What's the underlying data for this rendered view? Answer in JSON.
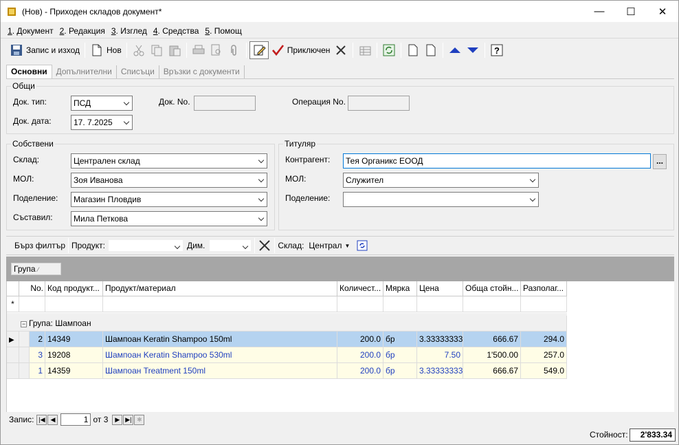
{
  "window": {
    "title": "(Нов) - Приходен складов документ*",
    "minimize": "—",
    "maximize": "☐",
    "close": "✕"
  },
  "menu": [
    {
      "key": "1",
      "label": ". Документ"
    },
    {
      "key": "2",
      "label": ". Редакция"
    },
    {
      "key": "3",
      "label": ". Изглед"
    },
    {
      "key": "4",
      "label": ". Средства"
    },
    {
      "key": "5",
      "label": ". Помощ"
    }
  ],
  "toolbar": {
    "save_exit": "Запис и изход",
    "new": "Нов",
    "finished": "Приключен"
  },
  "tabs": [
    "Основни",
    "Допълнителни",
    "Списъци",
    "Връзки с документи"
  ],
  "general": {
    "title": "Общи",
    "doc_type_label": "Док. тип:",
    "doc_type": "ПСД",
    "doc_no_label": "Док. No.",
    "doc_no": "",
    "operation_label": "Операция No.",
    "operation": "",
    "doc_date_label": "Док. дата:",
    "doc_date": "17.  7.2025"
  },
  "own": {
    "title": "Собствени",
    "warehouse_label": "Склад:",
    "warehouse": "Централен склад",
    "mol_label": "МОЛ:",
    "mol": "Зоя Иванова",
    "division_label": "Поделение:",
    "division": "Магазин Пловдив",
    "author_label": "Съставил:",
    "author": "Мила Петкова"
  },
  "holder": {
    "title": "Титуляр",
    "partner_label": "Контрагент:",
    "partner": "Тея Органикс ЕООД",
    "mol_label": "МОЛ:",
    "mol": "Служител",
    "division_label": "Поделение:",
    "division": "",
    "button": "..."
  },
  "filter": {
    "quick": "Бърз филтър",
    "product_label": "Продукт:",
    "product": "",
    "dim_label": "Дим.",
    "dim": "",
    "warehouse_label": "Склад:",
    "warehouse": "Централ"
  },
  "grouping": {
    "chip": "Група"
  },
  "grid": {
    "columns": [
      "No.",
      "Код продукт...",
      "Продукт/материал",
      "Количест...",
      "Мярка",
      "Цена",
      "Обща стойн...",
      "Разполаг..."
    ],
    "new_row_marker": "*",
    "group_label": "Група: Шампоан",
    "rows": [
      {
        "no": "2",
        "code": "14349",
        "name": "Шампоан Keratin Shampoo 150ml",
        "qty": "200.0",
        "unit": "бр",
        "price": "3.33333333",
        "total": "666.67",
        "avail": "294.0",
        "selected": true
      },
      {
        "no": "3",
        "code": "19208",
        "name": "Шампоан Keratin Shampoo 530ml",
        "qty": "200.0",
        "unit": "бр",
        "price": "7.50",
        "total": "1'500.00",
        "avail": "257.0",
        "selected": false
      },
      {
        "no": "1",
        "code": "14359",
        "name": "Шампоан Treatment 150ml",
        "qty": "200.0",
        "unit": "бр",
        "price": "3.33333333",
        "total": "666.67",
        "avail": "549.0",
        "selected": false
      }
    ]
  },
  "nav": {
    "label": "Запис:",
    "current": "1",
    "of": "от 3"
  },
  "footer": {
    "value_label": "Стойност:",
    "value": "2'833.34"
  }
}
